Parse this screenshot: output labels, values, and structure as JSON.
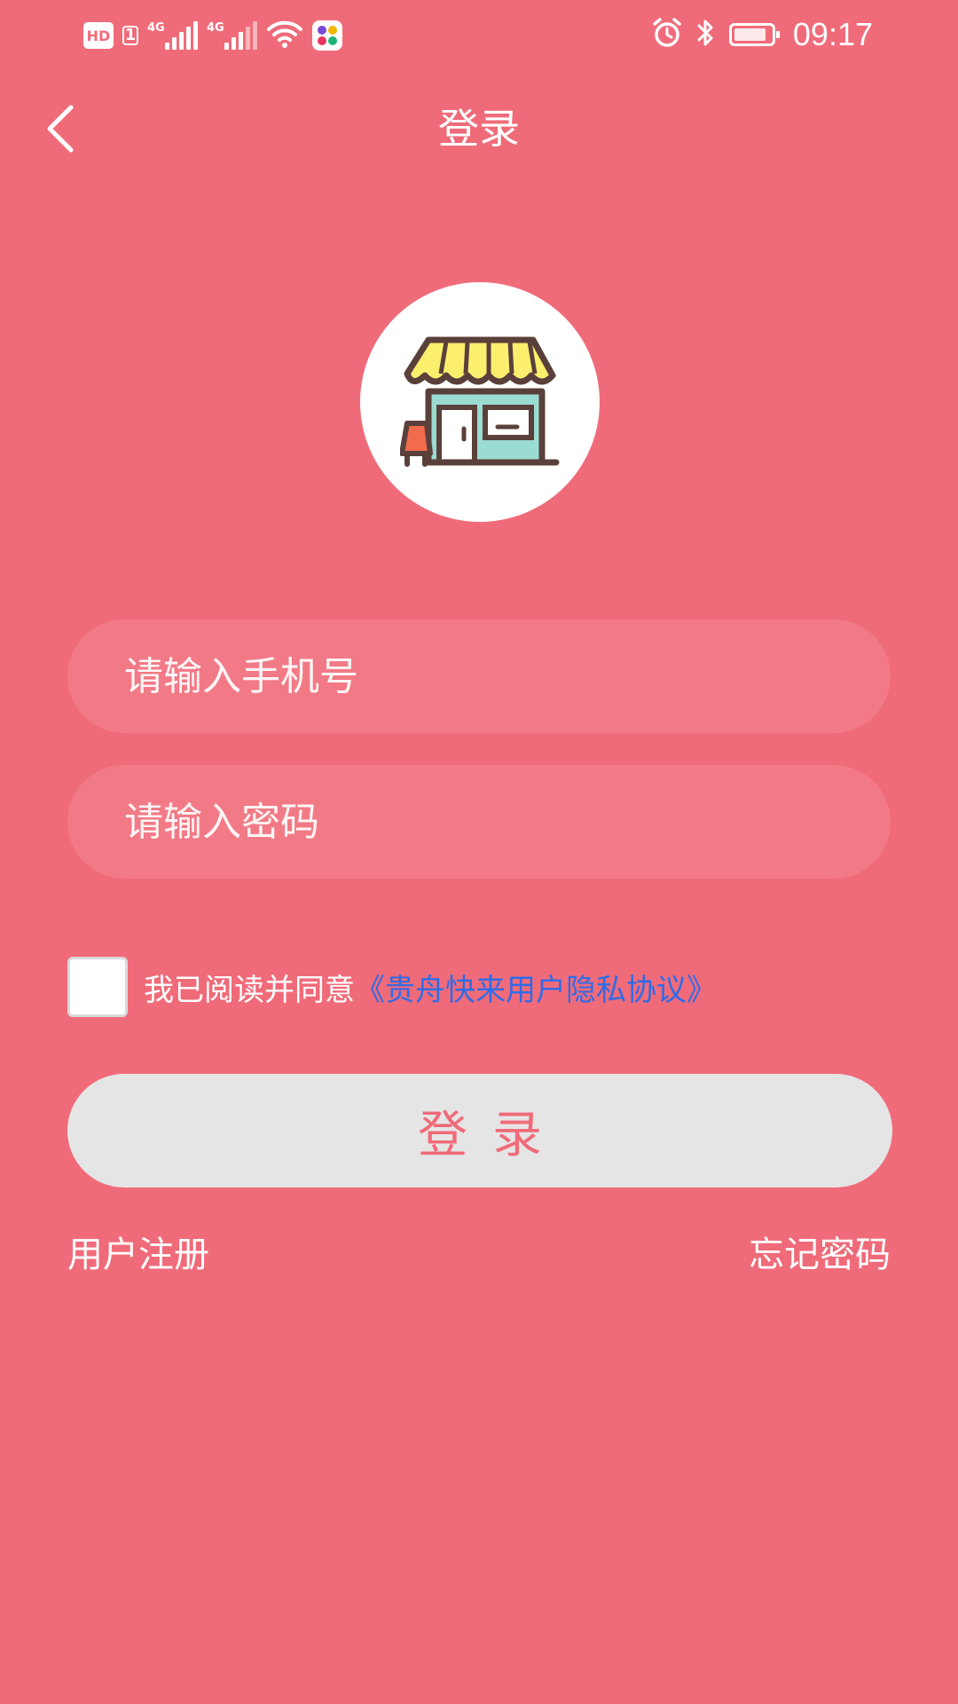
{
  "status_bar": {
    "hd_label": "HD",
    "sim_number": "1",
    "network_1": "4G",
    "network_2": "4G",
    "time": "09:17",
    "icons": [
      "hd-icon",
      "signal-icon",
      "signal-icon",
      "wifi-icon",
      "app-notification-icon",
      "alarm-icon",
      "bluetooth-icon",
      "battery-icon"
    ],
    "battery_level": 0.9
  },
  "header": {
    "title": "登录",
    "back_icon": "chevron-left-icon"
  },
  "logo": {
    "icon": "storefront-icon"
  },
  "form": {
    "phone_placeholder": "请输入手机号",
    "phone_value": "",
    "password_placeholder": "请输入密码",
    "password_value": "",
    "agree_text": "我已阅读并同意",
    "agree_link": "《贵舟快来用户隐私协议》",
    "agree_checked": false,
    "login_label": "登录"
  },
  "footer": {
    "register_label": "用户注册",
    "forgot_label": "忘记密码"
  },
  "colors": {
    "background": "#F06B79",
    "input_background": "#F27A86",
    "button_background": "#E6E5E6",
    "link": "#2F6BE8"
  }
}
